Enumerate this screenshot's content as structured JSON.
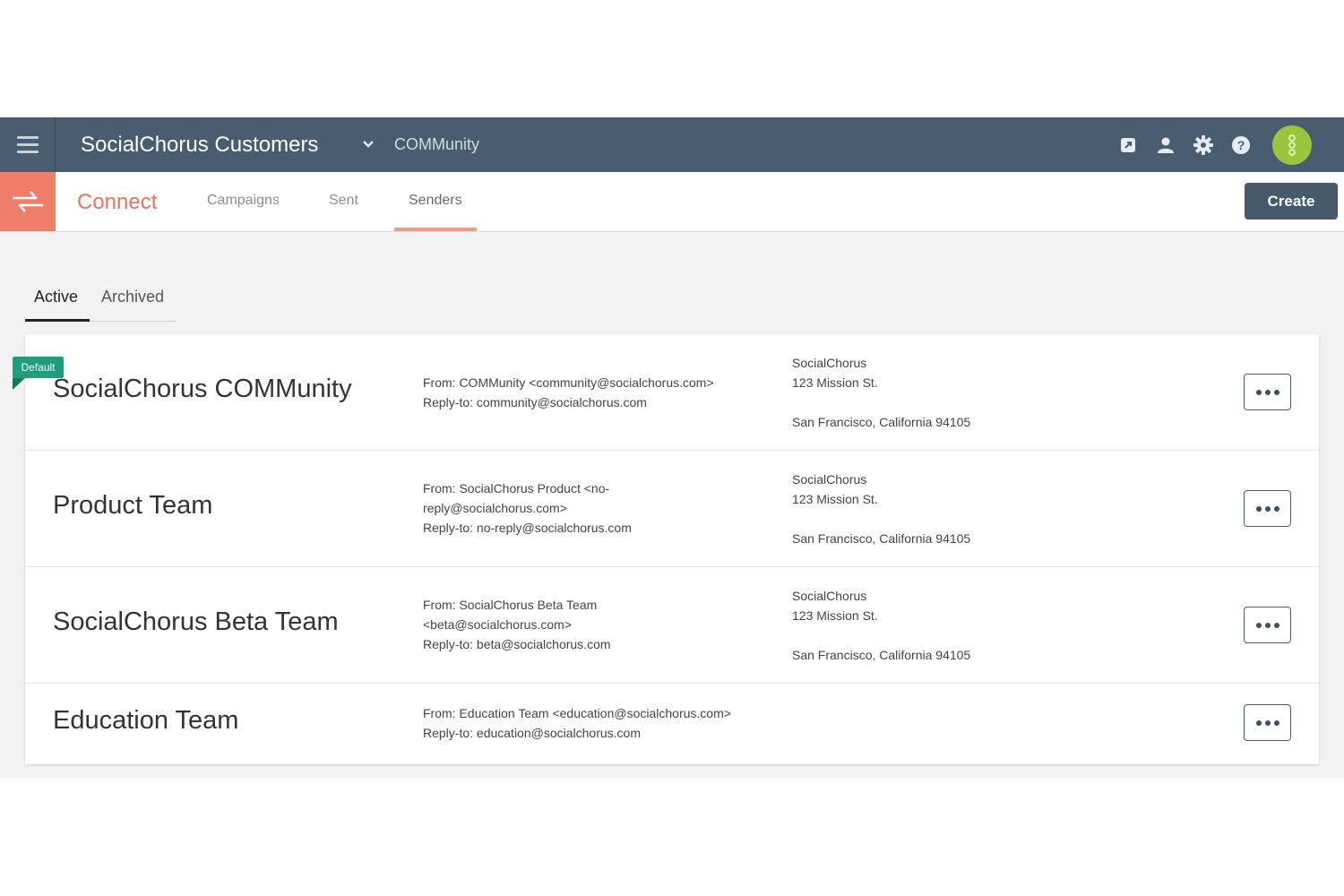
{
  "header": {
    "org_title": "SocialChorus Customers",
    "community": "COMMunity",
    "colors": {
      "bar": "#4a5d70",
      "avatar": "#9bc53d"
    },
    "icons": [
      "external-link-icon",
      "user-icon",
      "gear-icon",
      "help-icon",
      "avatar"
    ]
  },
  "app": {
    "name": "Connect",
    "color": "#ec6f5b",
    "tabs": [
      {
        "label": "Campaigns"
      },
      {
        "label": "Sent"
      },
      {
        "label": "Senders",
        "active": true
      }
    ],
    "create_label": "Create"
  },
  "subtabs": [
    {
      "label": "Active",
      "active": true
    },
    {
      "label": "Archived"
    }
  ],
  "default_badge": "Default",
  "senders": [
    {
      "name": "SocialChorus COMMunity",
      "from": [
        "From: COMMunity <community@socialchorus.com>",
        "Reply-to: community@socialchorus.com"
      ],
      "address": {
        "org": "SocialChorus",
        "street": "123 Mission St.",
        "city": "San Francisco, California 94105"
      }
    },
    {
      "name": "Product Team",
      "from": [
        "From: SocialChorus Product <no-",
        "reply@socialchorus.com>",
        "Reply-to: no-reply@socialchorus.com"
      ],
      "address": {
        "org": "SocialChorus",
        "street": "123 Mission St.",
        "city": "San Francisco, California 94105"
      }
    },
    {
      "name": "SocialChorus Beta Team",
      "from": [
        "From: SocialChorus Beta Team",
        "<beta@socialchorus.com>",
        "Reply-to: beta@socialchorus.com"
      ],
      "address": {
        "org": "SocialChorus",
        "street": "123 Mission St.",
        "city": "San Francisco, California 94105"
      }
    },
    {
      "name": "Education Team",
      "from": [
        "From: Education Team <education@socialchorus.com>",
        "Reply-to: education@socialchorus.com"
      ]
    }
  ]
}
